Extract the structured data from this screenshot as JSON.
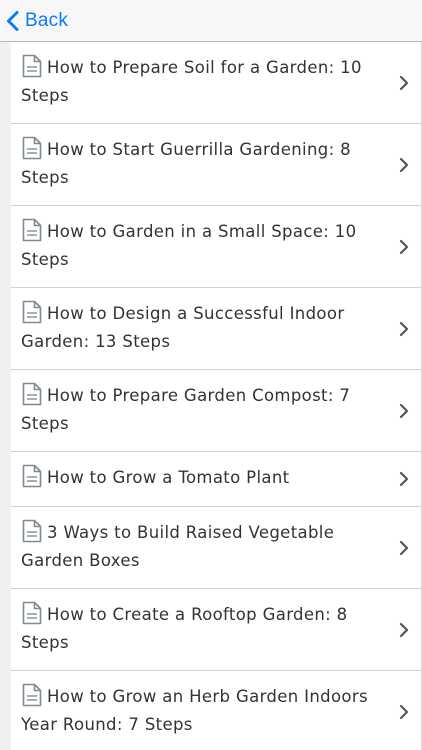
{
  "navbar": {
    "back_label": "Back",
    "icon": "chevron-left-icon",
    "accent_color": "#0a7cf6"
  },
  "list": {
    "item_icon": "document-icon",
    "disclosure_icon": "chevron-right-icon",
    "items": [
      {
        "label": "How to Prepare Soil for a Garden: 10 Steps"
      },
      {
        "label": "How to Start Guerrilla Gardening: 8 Steps"
      },
      {
        "label": "How to Garden in a Small Space: 10 Steps"
      },
      {
        "label": "How to Design a Successful Indoor Garden: 13 Steps"
      },
      {
        "label": "How to Prepare Garden Compost: 7 Steps"
      },
      {
        "label": "How to Grow a Tomato Plant"
      },
      {
        "label": "3 Ways to Build Raised Vegetable Garden Boxes"
      },
      {
        "label": "How to Create a Rooftop Garden: 8 Steps"
      },
      {
        "label": "How to Grow an Herb Garden Indoors Year Round: 7 Steps"
      }
    ]
  }
}
